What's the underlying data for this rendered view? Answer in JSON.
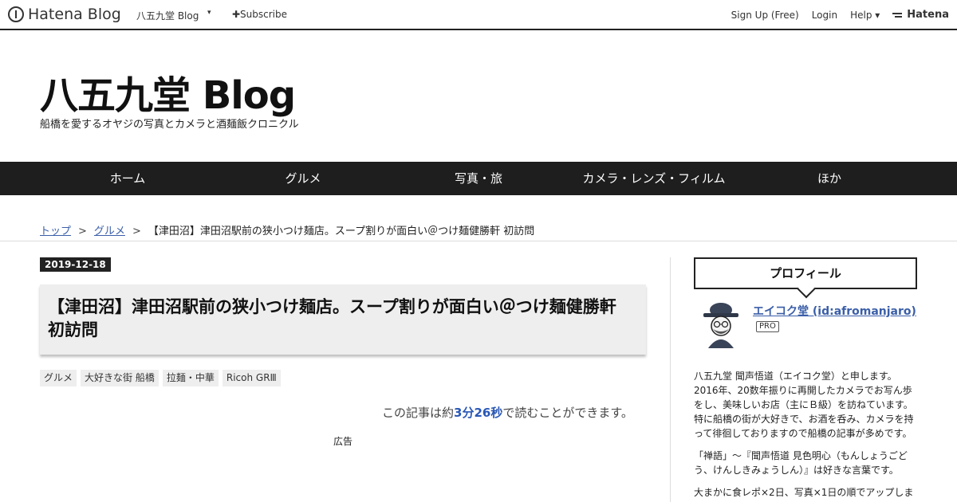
{
  "topbar": {
    "logo_text": "Hatena Blog",
    "blog_name": "八五九堂 Blog",
    "caret": "▾",
    "subscribe": "✚Subscribe",
    "signup": "Sign Up (Free)",
    "login": "Login",
    "help": "Help ▾",
    "hatena": "Hatena"
  },
  "header": {
    "title": "八五九堂 Blog",
    "description": "船橋を愛するオヤジの写真とカメラと酒麺飯クロニクル"
  },
  "nav": {
    "items": [
      {
        "label": "ホーム"
      },
      {
        "label": "グルメ"
      },
      {
        "label": "写真・旅"
      },
      {
        "label": "カメラ・レンズ・フィルム"
      },
      {
        "label": "ほか"
      }
    ]
  },
  "breadcrumb": {
    "top": "トップ",
    "sep": ">",
    "category": "グルメ",
    "current": "【津田沼】津田沼駅前の狭小つけ麺店。スープ割りが面白い＠つけ麺健勝軒 初訪問"
  },
  "entry": {
    "date": "2019-12-18",
    "title": "【津田沼】津田沼駅前の狭小つけ麺店。スープ割りが面白い＠つけ麺健勝軒 初訪問",
    "tags": [
      "グルメ",
      "大好きな街 船橋",
      "拉麺・中華",
      "Ricoh GRⅢ"
    ],
    "readtime_prefix": "この記事は約",
    "readtime_value": "3分26秒",
    "readtime_suffix": "で読むことができます。",
    "ad_label": "広告"
  },
  "sidebar": {
    "profile_heading": "プロフィール",
    "author": "エイコク堂 (id:afromanjaro)",
    "badge": "PRO",
    "paragraphs": [
      "八五九堂 聞声悟道（エイコク堂）と申します。2016年、20数年振りに再開したカメラでお写ん歩をし、美味しいお店（主にＢ級）を訪ねています。特に船橋の街が大好きで、お酒を呑み、カメラを持って徘徊しておりますので船橋の記事が多めです。",
      "「禅語」～『聞声悟道 見色明心（もんしょうごどう、けんしきみょうしん）』は好きな言葉です。",
      "大まかに食レポ×2日、写真×1日の順でアップしま"
    ]
  }
}
